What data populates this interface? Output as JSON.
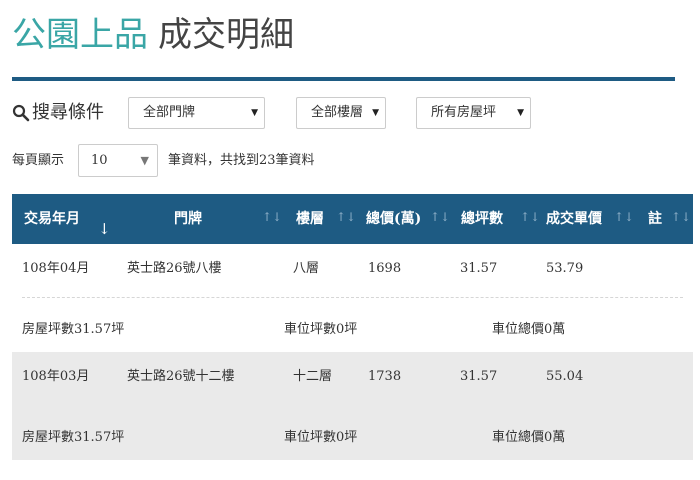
{
  "page": {
    "title_brand": "公園上品",
    "title_rest": "成交明細"
  },
  "search": {
    "label": "搜尋條件",
    "filters": [
      {
        "selected": "全部門牌"
      },
      {
        "selected": "全部樓層"
      },
      {
        "selected": "所有房屋坪"
      }
    ]
  },
  "paging": {
    "per_page_label": "每頁顯示",
    "per_page_value": "10",
    "result_text": "筆資料，共找到23筆資料"
  },
  "table": {
    "headers": [
      "交易年月",
      "門牌",
      "樓層",
      "總價(萬)",
      "總坪數",
      "成交單價",
      "註"
    ],
    "rows": [
      {
        "date": "108年04月",
        "address": "英士路26號八樓",
        "floor": "八層",
        "total_price": "1698",
        "total_area": "31.57",
        "unit_price": "53.79",
        "note": "",
        "house_area": "房屋坪數31.57坪",
        "parking_area": "車位坪數0坪",
        "parking_price": "車位總價0萬"
      },
      {
        "date": "108年03月",
        "address": "英士路26號十二樓",
        "floor": "十二層",
        "total_price": "1738",
        "total_area": "31.57",
        "unit_price": "55.04",
        "note": "",
        "house_area": "房屋坪數31.57坪",
        "parking_area": "車位坪數0坪",
        "parking_price": "車位總價0萬"
      }
    ]
  },
  "icons": {
    "search": "search-icon",
    "dropdown": "caret-down-icon",
    "sort": "sort-arrows-icon",
    "sort_active": "arrow-down-icon"
  },
  "colors": {
    "brand": "#3aa6a6",
    "header_bg": "#1e5b83",
    "row_alt_bg": "#eaeaea"
  }
}
